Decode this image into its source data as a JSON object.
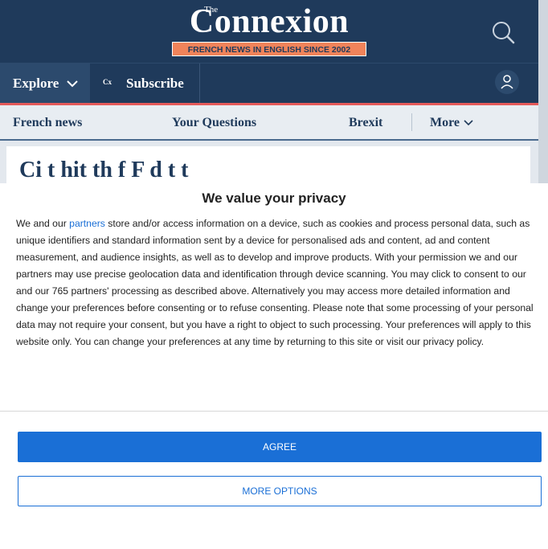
{
  "header": {
    "logo_small": "The",
    "logo_word": "Connexion",
    "tagline": "FRENCH NEWS IN ENGLISH SINCE 2002",
    "search_icon": "search-icon",
    "user_icon": "user-icon"
  },
  "nav": {
    "explore_label": "Explore",
    "subscribe_badge": "Cx",
    "subscribe_label": "Subscribe"
  },
  "secondary_nav": {
    "items": [
      {
        "label": "French news"
      },
      {
        "label": "Your Questions"
      },
      {
        "label": "Brexit"
      },
      {
        "label": "More"
      }
    ]
  },
  "article": {
    "title_partial": "Ci     t     hit     th   f F           d  t          t"
  },
  "consent": {
    "title": "We value your privacy",
    "body_prefix": "We and our ",
    "partners_link": "partners",
    "body_rest": " store and/or access information on a device, such as cookies and process personal data, such as unique identifiers and standard information sent by a device for personalised ads and content, ad and content measurement, and audience insights, as well as to develop and improve products. With your permission we and our partners may use precise geolocation data and identification through device scanning. You may click to consent to our and our 765 partners' processing as described above. Alternatively you may access more detailed information and change your preferences before consenting or to refuse consenting. Please note that some processing of your personal data may not require your consent, but you have a right to object to such processing. Your preferences will apply to this website only. You can change your preferences at any time by returning to this site or visit our privacy policy.",
    "agree_label": "AGREE",
    "more_label": "MORE OPTIONS"
  },
  "colors": {
    "brand_navy": "#1f3a5b",
    "accent_orange": "#f0835a",
    "accent_red": "#e45a5a",
    "consent_blue": "#1a6fd6"
  }
}
